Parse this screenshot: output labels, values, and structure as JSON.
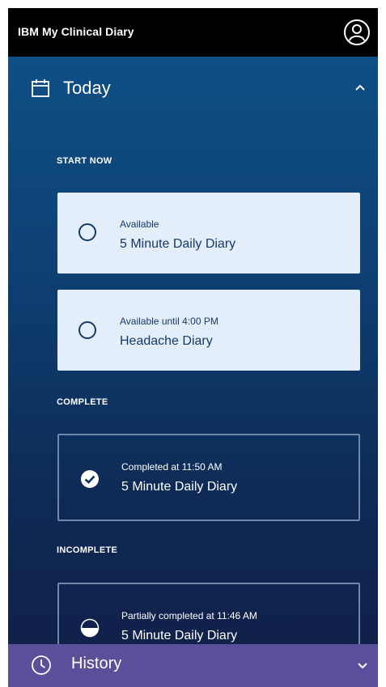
{
  "app": {
    "title": "IBM My Clinical Diary"
  },
  "today": {
    "label": "Today",
    "expanded": true
  },
  "sections": {
    "start_now": "START NOW",
    "complete": "COMPLETE",
    "incomplete": "INCOMPLETE"
  },
  "cards": {
    "start_now": [
      {
        "status": "Available",
        "title": "5 Minute Daily Diary",
        "icon": "empty-circle-icon"
      },
      {
        "status": "Available until 4:00 PM",
        "title": "Headache Diary",
        "icon": "empty-circle-icon"
      }
    ],
    "complete": [
      {
        "status": "Completed at 11:50 AM",
        "title": "5 Minute Daily Diary",
        "icon": "checkmark-circle-icon"
      }
    ],
    "incomplete": [
      {
        "status": "Partially completed at 11:46 AM",
        "title": "5 Minute Daily Diary",
        "icon": "half-circle-icon"
      }
    ]
  },
  "history": {
    "label": "History",
    "expanded": false
  },
  "colors": {
    "appbar": "#000000",
    "content_top": "#0f4f86",
    "content_bottom": "#10214a",
    "card_available_bg": "#e4eefb",
    "card_available_text": "#123a6a",
    "history_bar": "#5b4f9c"
  }
}
